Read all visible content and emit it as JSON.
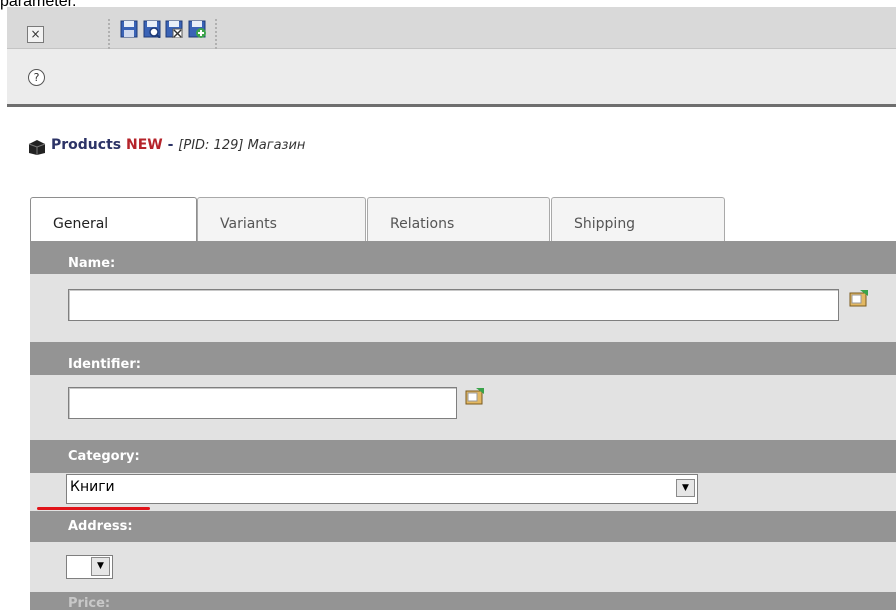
{
  "top_cropped_text": "parameter.",
  "toolbar": {
    "close_icon": "close-icon",
    "buttons": [
      {
        "name": "save-icon",
        "color": "#3a63b6"
      },
      {
        "name": "save-view-icon",
        "color": "#3a63b6"
      },
      {
        "name": "save-close-icon",
        "color": "#3a63b6"
      },
      {
        "name": "save-new-icon",
        "color": "#3a63b6"
      }
    ]
  },
  "help": {
    "symbol": "?"
  },
  "header": {
    "title": "Products",
    "new": "NEW",
    "dash": "-",
    "pid": "[PID: 129] Магазин"
  },
  "tabs": [
    {
      "label": "General",
      "active": true
    },
    {
      "label": "Variants",
      "active": false
    },
    {
      "label": "Relations",
      "active": false
    },
    {
      "label": "Shipping",
      "active": false
    }
  ],
  "form": {
    "name_label": "Name:",
    "name_value": "",
    "identifier_label": "Identifier:",
    "identifier_value": "",
    "category_label": "Category:",
    "category_value": "Книги",
    "address_label": "Address:",
    "address_value": "",
    "price_label": "Price:"
  },
  "colors": {
    "section_header": "#949494",
    "form_background": "#e2e2e2",
    "new_badge": "#b5232a",
    "title": "#2c3366",
    "annotation_underline": "#e1141a"
  }
}
